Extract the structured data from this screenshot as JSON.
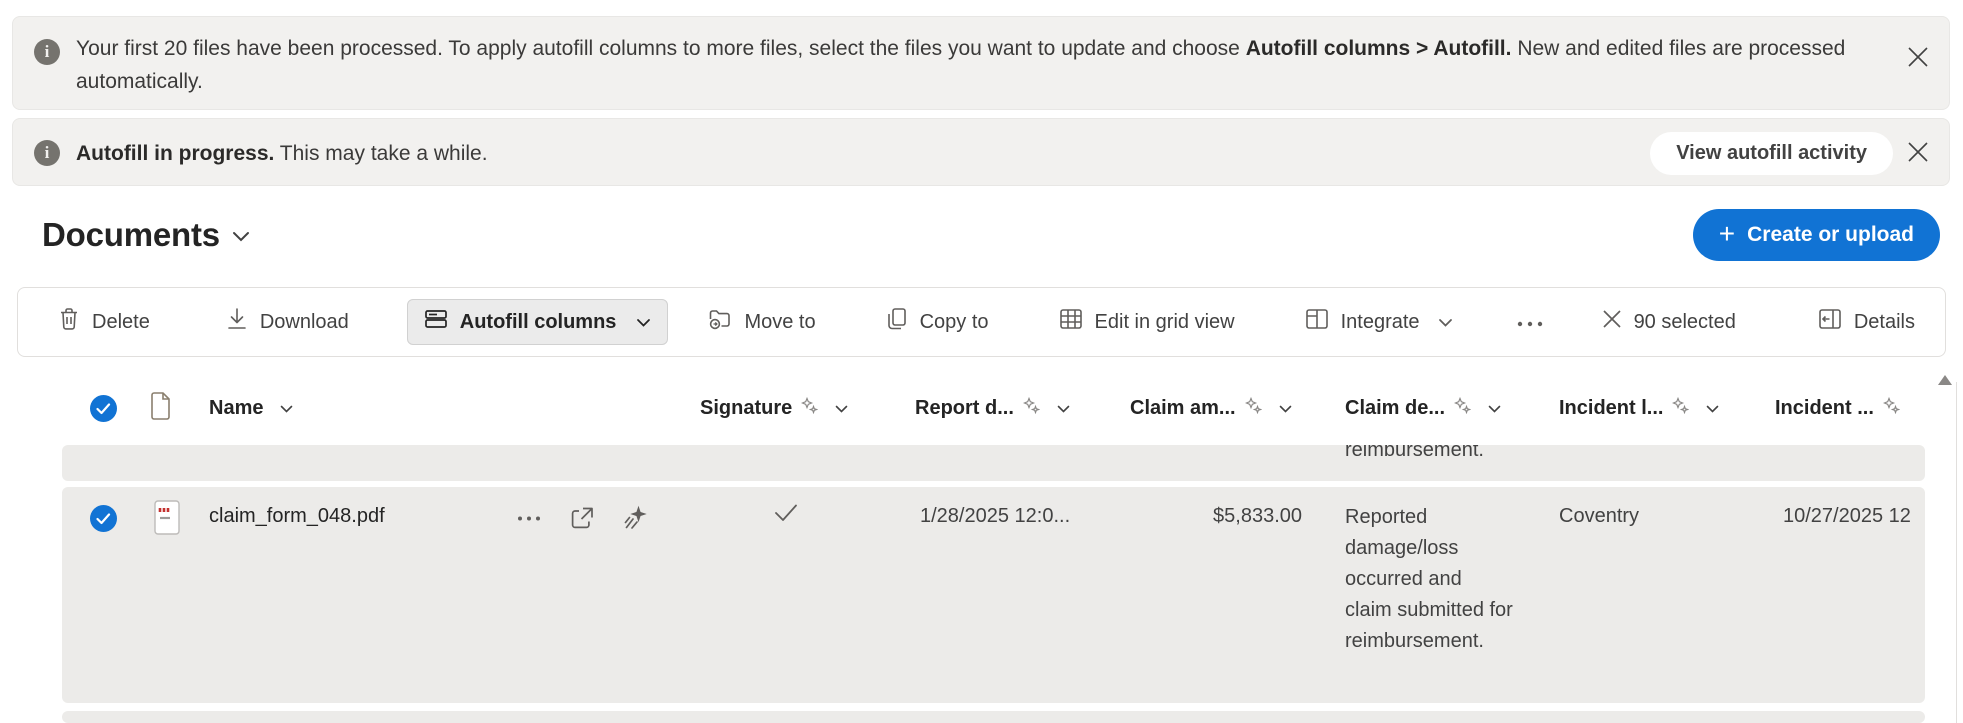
{
  "colors": {
    "accent_blue": "#1173d4",
    "banner_bg": "#f2f1ef",
    "row_selected_bg": "#ecebe9",
    "toolbar_pill_bg": "#ebebeb",
    "text_dark": "#242424",
    "text_gray": "#424242"
  },
  "banners": {
    "processed": {
      "text_before": "Your first 20 files have been processed. To apply autofill columns to more files, select the files you want to update and choose ",
      "text_bold": "Autofill columns > Autofill.",
      "text_after": " New and edited files are processed automatically."
    },
    "progress": {
      "text_bold": "Autofill in progress.",
      "text_after": " This may take a while.",
      "button_label": "View autofill activity"
    }
  },
  "header": {
    "title": "Documents",
    "create_button": "Create or upload",
    "plus": "+"
  },
  "toolbar": {
    "delete": "Delete",
    "download": "Download",
    "autofill_columns": "Autofill columns",
    "move_to": "Move to",
    "copy_to": "Copy to",
    "edit_grid": "Edit in grid view",
    "integrate": "Integrate",
    "selected": "90 selected",
    "details": "Details"
  },
  "table": {
    "columns": [
      {
        "label": "Name"
      },
      {
        "label": "Signature"
      },
      {
        "label": "Report d..."
      },
      {
        "label": "Claim am..."
      },
      {
        "label": "Claim de..."
      },
      {
        "label": "Incident l..."
      },
      {
        "label": "Incident ..."
      }
    ],
    "partial_row_text": "reimbursement.",
    "row": {
      "name": "claim_form_048.pdf",
      "report_date": "1/28/2025 12:0...",
      "amount": "$5,833.00",
      "description": "Reported damage/loss occurred and claim submitted for reimbursement.",
      "location": "Coventry",
      "incident_date": "10/27/2025 12"
    }
  }
}
